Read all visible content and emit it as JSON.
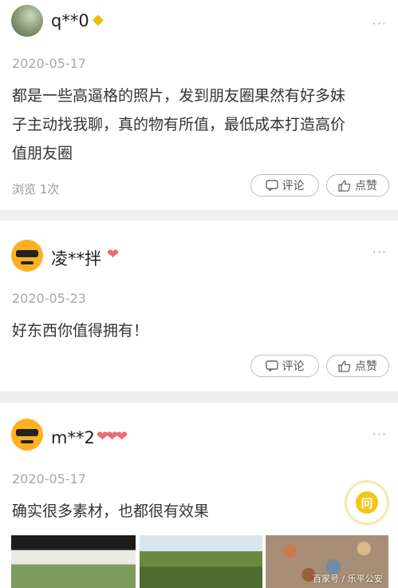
{
  "posts": [
    {
      "username": "q**0",
      "badge_icon": "gem-icon",
      "date": "2020-05-17",
      "content_lines": [
        "都是一些高逼格的照片，发到朋友圈果然有好多妹",
        "子主动找我聊，真的物有所值，最低成本打造高价",
        "值朋友圈"
      ],
      "views": "浏览 1次",
      "comment_label": "评论",
      "like_label": "点赞"
    },
    {
      "username": "凌**拌",
      "badge_icon": "heart-icon",
      "date": "2020-05-23",
      "content_lines": [
        "好东西你值得拥有！"
      ],
      "comment_label": "评论",
      "like_label": "点赞"
    },
    {
      "username": "m**2",
      "badge_icon": "hearts-icon",
      "date": "2020-05-17",
      "content_lines": [
        "确实很多素材，也都很有效果"
      ]
    }
  ],
  "more_glyph": "···",
  "fab_label": "问",
  "watermark": "百家号 / 乐平公安",
  "colors": {
    "badge_gold": "#f2b90e",
    "badge_pink": "#ef6a78",
    "fab_yellow": "#f3c51a"
  }
}
